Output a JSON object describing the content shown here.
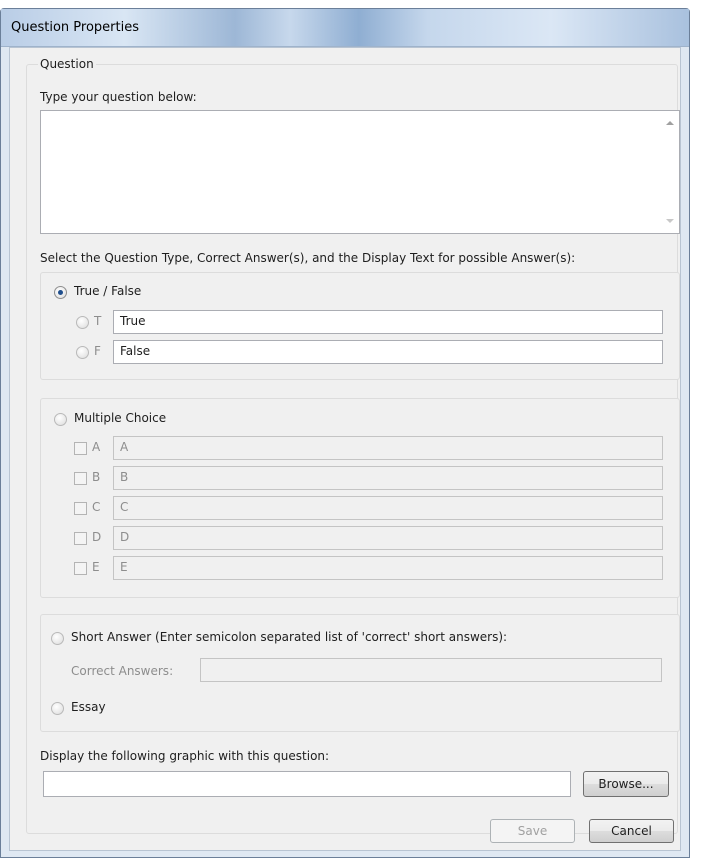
{
  "window": {
    "title": "Question Properties"
  },
  "question_group": {
    "legend": "Question",
    "prompt_label": "Type your question below:",
    "question_text": ""
  },
  "type_section": {
    "instruction": "Select the Question Type, Correct Answer(s), and the Display Text for possible Answer(s):"
  },
  "true_false": {
    "label": "True / False",
    "selected": true,
    "options": [
      {
        "letter": "T",
        "text": "True"
      },
      {
        "letter": "F",
        "text": "False"
      }
    ]
  },
  "multiple_choice": {
    "label": "Multiple Choice",
    "selected": false,
    "options": [
      {
        "letter": "A",
        "text": "A"
      },
      {
        "letter": "B",
        "text": "B"
      },
      {
        "letter": "C",
        "text": "C"
      },
      {
        "letter": "D",
        "text": "D"
      },
      {
        "letter": "E",
        "text": "E"
      }
    ]
  },
  "short_answer": {
    "label": "Short Answer (Enter semicolon separated list of 'correct' short answers):",
    "correct_answers_label": "Correct Answers:",
    "correct_answers_value": ""
  },
  "essay": {
    "label": "Essay"
  },
  "graphic": {
    "label": "Display the following graphic with this question:",
    "path_value": "",
    "browse_label": "Browse..."
  },
  "footer": {
    "save_label": "Save",
    "cancel_label": "Cancel"
  },
  "colors": {
    "title_bar": "#b9cde6",
    "client_bg": "#f0f0f0",
    "radio_dot": "#1f4e8c"
  }
}
